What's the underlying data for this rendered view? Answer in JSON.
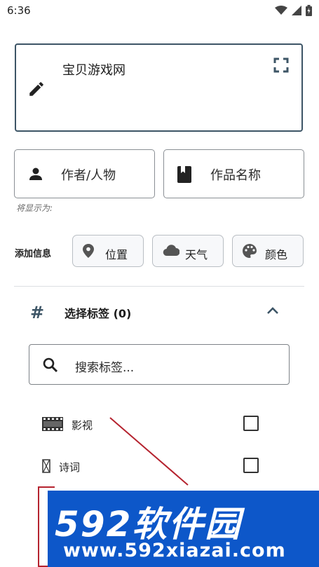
{
  "status_bar": {
    "time": "6:36",
    "icons": [
      "wifi-icon",
      "signal-icon",
      "battery-icon"
    ]
  },
  "editor": {
    "title": "宝贝游戏网",
    "icons": [
      "pencil-icon",
      "fullscreen-icon"
    ]
  },
  "fields": {
    "author": {
      "label": "作者/人物",
      "icon": "person-icon"
    },
    "work": {
      "label": "作品名称",
      "icon": "book-icon"
    },
    "hint": "将显示为:"
  },
  "add_info": {
    "label": "添加信息",
    "chips": [
      {
        "label": "位置",
        "icon": "location-pin-icon"
      },
      {
        "label": "天气",
        "icon": "cloud-icon"
      },
      {
        "label": "颜色",
        "icon": "palette-icon"
      }
    ]
  },
  "tags": {
    "header_icon": "#",
    "header": "选择标签 (0)",
    "search_placeholder": "搜索标签...",
    "items": [
      {
        "label": "影视",
        "icon": "film-icon",
        "checked": false
      },
      {
        "label": "诗词",
        "icon": "scroll-icon",
        "checked": false
      }
    ]
  },
  "watermark": {
    "logo": "592软件园",
    "url": "www.592xiazai.com"
  },
  "colors": {
    "accent": "#3d5566",
    "annotation": "#b5232f",
    "watermark_bg": "#0d57c9"
  }
}
